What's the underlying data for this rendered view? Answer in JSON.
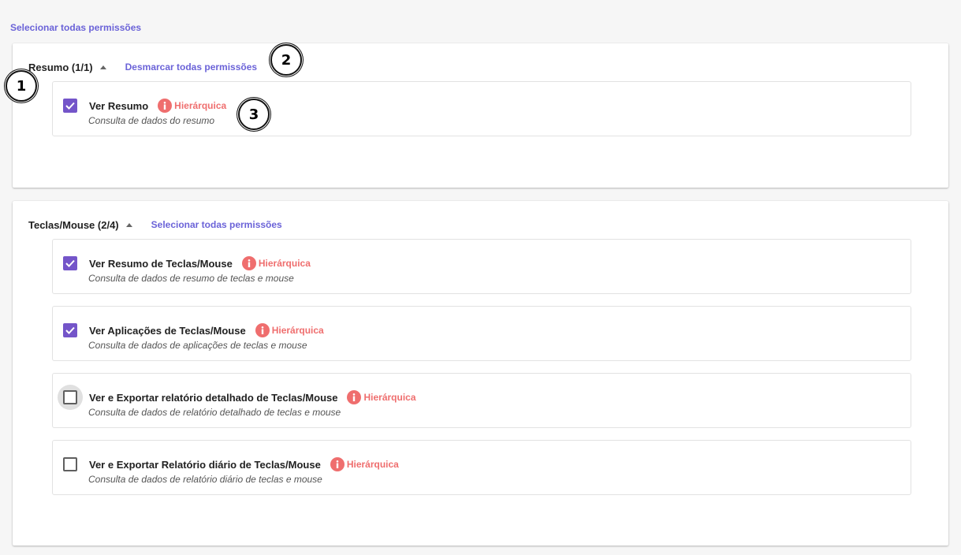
{
  "top_link": "Selecionar todas permissões",
  "colors": {
    "accent": "#6b63d8",
    "checkbox": "#7455c9",
    "hierarchy": "#ef6e6e"
  },
  "sections": [
    {
      "title": "Resumo (1/1)",
      "action": "Desmarcar todas permissões",
      "expanded": true,
      "permissions": [
        {
          "title": "Ver Resumo",
          "badge": "Hierárquica",
          "description": "Consulta de dados do resumo",
          "checked": true
        }
      ]
    },
    {
      "title": "Teclas/Mouse (2/4)",
      "action": "Selecionar todas permissões",
      "expanded": true,
      "permissions": [
        {
          "title": "Ver Resumo de Teclas/Mouse",
          "badge": "Hierárquica",
          "description": "Consulta de dados de resumo de teclas e mouse",
          "checked": true
        },
        {
          "title": "Ver Aplicações de Teclas/Mouse",
          "badge": "Hierárquica",
          "description": "Consulta de dados de aplicações de teclas e mouse",
          "checked": true
        },
        {
          "title": "Ver e Exportar relatório detalhado de Teclas/Mouse",
          "badge": "Hierárquica",
          "description": "Consulta de dados de relatório detalhado de teclas e mouse",
          "checked": false,
          "focused": true
        },
        {
          "title": "Ver e Exportar Relatório diário de Teclas/Mouse",
          "badge": "Hierárquica",
          "description": "Consulta de dados de relatório diário de teclas e mouse",
          "checked": false
        }
      ]
    }
  ],
  "annotations": [
    "1",
    "2",
    "3"
  ],
  "icons": {
    "info": "info-icon",
    "check": "check-icon",
    "caret": "caret-up-icon"
  }
}
